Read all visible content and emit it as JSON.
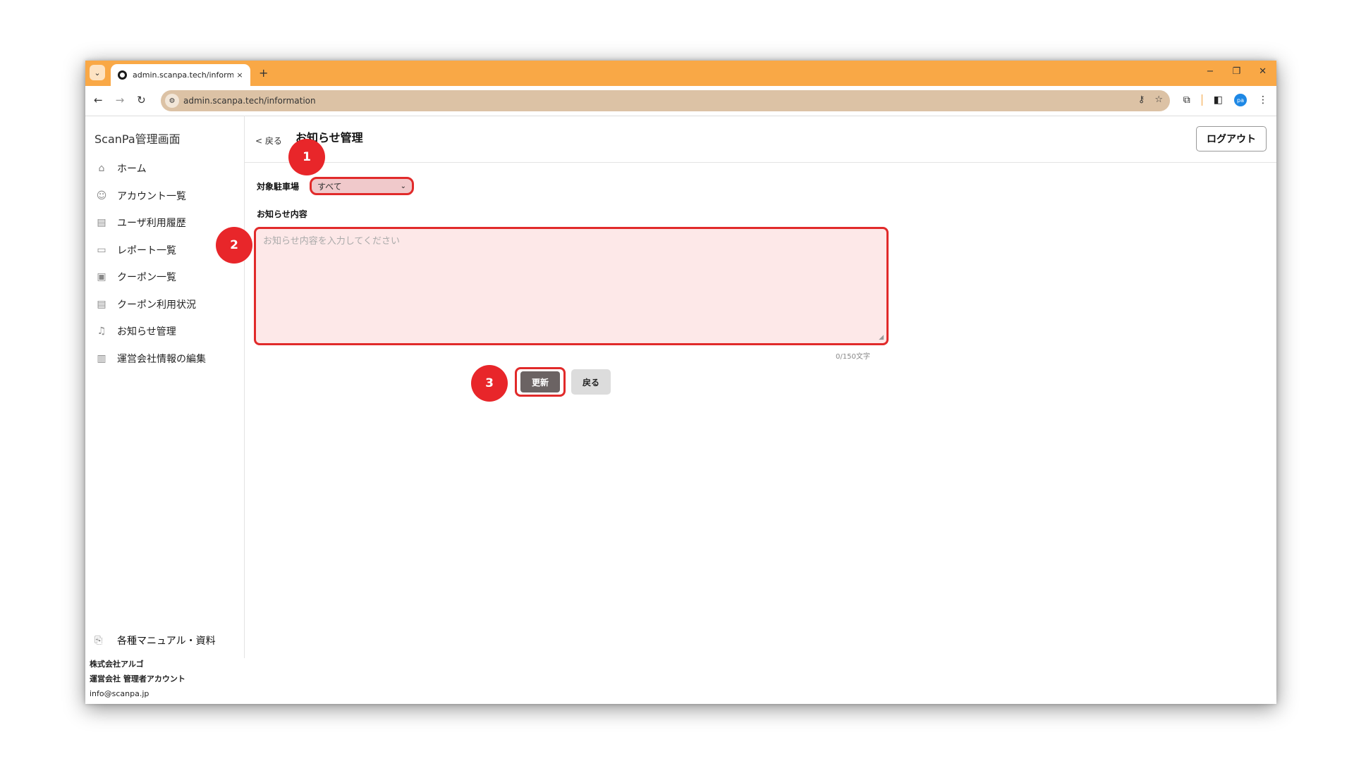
{
  "browser": {
    "tab_title": "admin.scanpa.tech/information",
    "tab_close": "×",
    "new_tab": "+",
    "url": "admin.scanpa.tech/information",
    "profile_initials": "pa"
  },
  "sidebar": {
    "brand": "ScanPa管理画面",
    "items": [
      {
        "label": "ホーム",
        "icon": "home-icon"
      },
      {
        "label": "アカウント一覧",
        "icon": "users-icon"
      },
      {
        "label": "ユーザ利用履歴",
        "icon": "history-icon"
      },
      {
        "label": "レポート一覧",
        "icon": "report-icon"
      },
      {
        "label": "クーポン一覧",
        "icon": "coupon-icon"
      },
      {
        "label": "クーポン利用状況",
        "icon": "coupon-usage-icon"
      },
      {
        "label": "お知らせ管理",
        "icon": "bell-icon"
      },
      {
        "label": "運営会社情報の編集",
        "icon": "building-icon"
      }
    ],
    "manual": "各種マニュアル・資料",
    "company": "株式会社アルゴ",
    "account": "運営会社 管理者アカウント",
    "email": "info@scanpa.jp"
  },
  "header": {
    "back": "< 戻る",
    "title": "お知らせ管理",
    "logout": "ログアウト"
  },
  "form": {
    "target_label": "対象駐車場",
    "target_value": "すべて",
    "content_label": "お知らせ内容",
    "content_placeholder": "お知らせ内容を入力してください",
    "counter": "0/150文字",
    "update_button": "更新",
    "back_button": "戻る"
  },
  "annotations": [
    "1",
    "2",
    "3"
  ],
  "colors": {
    "browser_frame": "#f9a846",
    "highlight": "#e12a2a",
    "badge": "#e8262a",
    "update_button": "#6b6363"
  }
}
